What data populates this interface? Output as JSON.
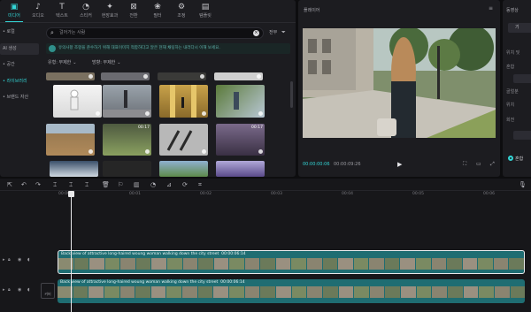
{
  "toolbar": {
    "tools": [
      {
        "label": "미디어",
        "icon": "media-icon",
        "active": true
      },
      {
        "label": "오디오",
        "icon": "audio-icon"
      },
      {
        "label": "텍스트",
        "icon": "text-icon"
      },
      {
        "label": "스티커",
        "icon": "sticker-icon"
      },
      {
        "label": "현장효과",
        "icon": "effects-icon"
      },
      {
        "label": "전환",
        "icon": "transition-icon"
      },
      {
        "label": "필터",
        "icon": "filter-icon"
      },
      {
        "label": "조정",
        "icon": "adjust-icon"
      },
      {
        "label": "템플릿",
        "icon": "template-icon"
      }
    ]
  },
  "sidebar": {
    "items": [
      {
        "label": "• 로컬"
      },
      {
        "label": "AI 생성"
      },
      {
        "label": "• 공간"
      },
      {
        "label": "• 라이브러리",
        "active": true
      },
      {
        "label": "• 브랜드 자산"
      }
    ]
  },
  "search": {
    "placeholder": "걸어가는 사람",
    "filter_label": "전부"
  },
  "notice": {
    "text": "유의사항 조항을 준수하기 위해 대표이미지 적합하다고 알은 현재 채팅하는 내러다시 이해 보세요."
  },
  "dropdowns": [
    {
      "label": "유형: 무제한"
    },
    {
      "label": "방향: 무제한"
    }
  ],
  "media_items": [
    {
      "duration": ""
    },
    {
      "duration": ""
    },
    {
      "duration": ""
    },
    {
      "duration": ""
    },
    {
      "duration": ""
    },
    {
      "duration": ""
    },
    {
      "duration": ""
    },
    {
      "duration": ""
    },
    {
      "duration": ""
    },
    {
      "duration": "00:17"
    },
    {
      "duration": ""
    },
    {
      "duration": "00:17"
    },
    {
      "duration": ""
    },
    {
      "duration": ""
    },
    {
      "duration": ""
    },
    {
      "duration": ""
    }
  ],
  "player": {
    "title": "플레이어",
    "current_time": "00:00:00:06",
    "total_time": "00:00:09:26"
  },
  "props": {
    "title": "동영상",
    "tab": "기",
    "rows": [
      "위치 및",
      "크기",
      "혼합",
      "",
      "골얼분",
      "위치",
      "회전"
    ],
    "radio_label": "혼합"
  },
  "timeline": {
    "ruler_labels": [
      "00:00",
      "00:01",
      "00:02",
      "00:03",
      "00:04",
      "00:05",
      "00:06"
    ],
    "clip_label": "Back view of attractive long-haired woung woman walking down the city street",
    "clip_duration": "00:00:06:14",
    "cover_label": "커버"
  },
  "colors": {
    "accent": "#33d6d6",
    "clip": "#1f6d72",
    "panel": "#1c1c20",
    "background": "#0d0d0f"
  }
}
